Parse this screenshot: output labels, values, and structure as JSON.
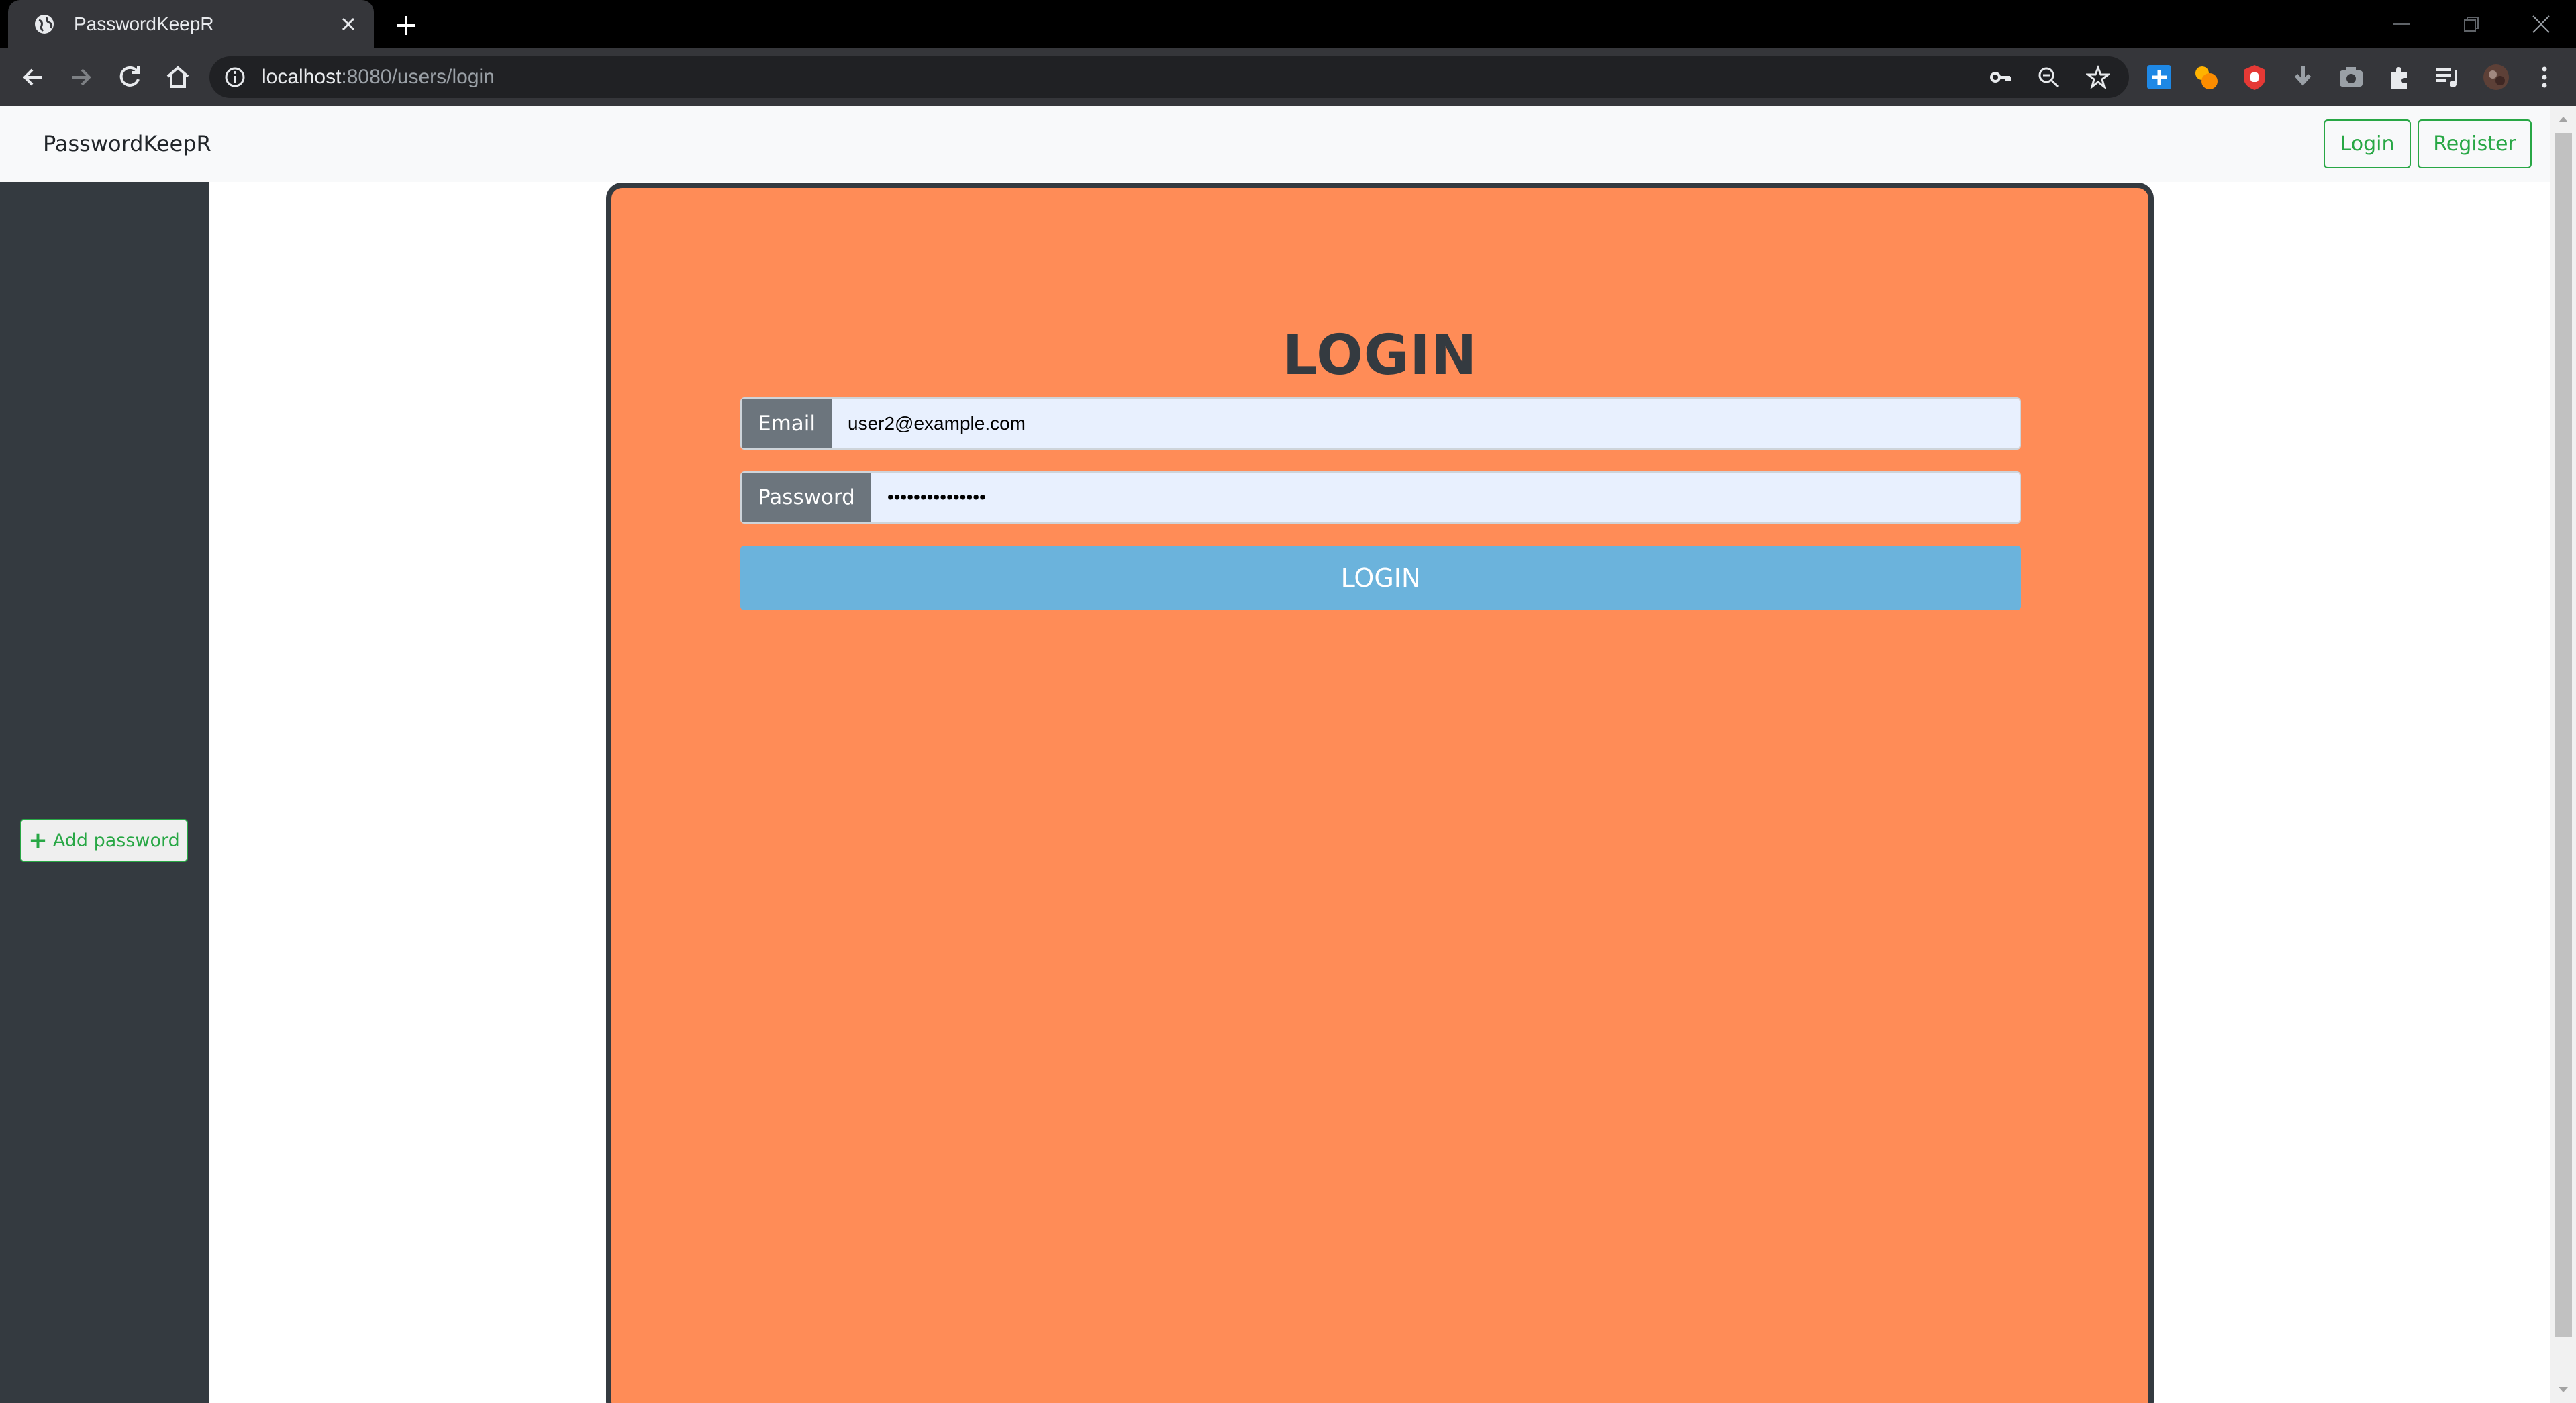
{
  "browser": {
    "tab_title": "PasswordKeepR",
    "url_host": "localhost",
    "url_path": ":8080/users/login",
    "icons": [
      "globe-icon",
      "close-icon",
      "plus-icon",
      "minimize-icon",
      "restore-icon",
      "close-window-icon",
      "back-icon",
      "forward-icon",
      "reload-icon",
      "home-icon",
      "info-icon",
      "key-icon",
      "zoom-icon",
      "star-icon",
      "extensions-icon",
      "media-icon",
      "profile-avatar",
      "menu-icon"
    ]
  },
  "navbar": {
    "brand": "PasswordKeepR",
    "login_label": "Login",
    "register_label": "Register"
  },
  "sidebar": {
    "add_password_label": "Add password"
  },
  "login_form": {
    "title": "LOGIN",
    "email_label": "Email",
    "email_value": "user2@example.com",
    "password_label": "Password",
    "password_value": "•••••••••••••••",
    "submit_label": "LOGIN"
  },
  "colors": {
    "card_background": "#ff8c57",
    "sidebar_background": "#343a40",
    "accent_green": "#28a745",
    "submit_button": "#6bb3dc",
    "input_label": "#6c757d",
    "input_autofill": "#e8f0fe"
  }
}
